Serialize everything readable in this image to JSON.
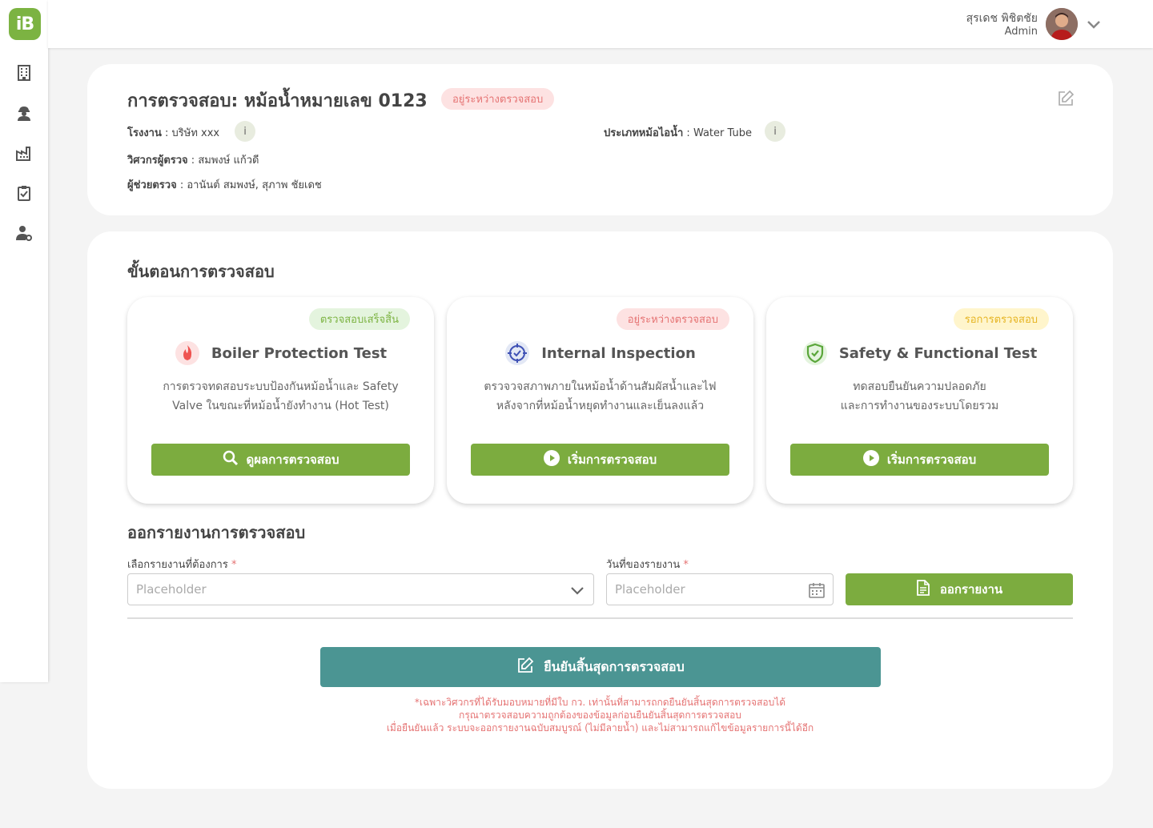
{
  "app": {
    "logo_text": "iB"
  },
  "user": {
    "name": "สุรเดช พิชิตชัย",
    "role": "Admin"
  },
  "inspection": {
    "title": "การตรวจสอบ: หม้อน้ำหมายเลข 0123",
    "status": "อยู่ระหว่างตรวจสอบ",
    "factory_label": "โรงงาน",
    "factory_value": "บริษัท xxx",
    "boiler_type_label": "ประเภทหม้อไอน้ำ",
    "boiler_type_value": "Water Tube",
    "engineer_label": "วิศวกรผู้ตรวจ",
    "engineer_value": "สมพงษ์ แก้วดี",
    "assistant_label": "ผู้ช่วยตรวจ",
    "assistant_value": "อานันต์ สมพงษ์, สุภาพ ชัยเดช",
    "info_icon": "i"
  },
  "steps_section": {
    "title": "ขั้นตอนการตรวจสอบ",
    "steps": [
      {
        "status": "ตรวจสอบเสร็จสิ้น",
        "title": "Boiler Protection Test",
        "desc_line1": "การตรวจทดสอบระบบป้องกันหม้อน้ำและ Safety",
        "desc_line2": "Valve ในขณะที่หม้อน้ำยังทำงาน (Hot Test)",
        "button": "ดูผลการตรวจสอบ",
        "icon": "flame-icon"
      },
      {
        "status": "อยู่ระหว่างตรวจสอบ",
        "title": "Internal Inspection",
        "desc_line1": "ตรวจวจสภาพภายในหม้อน้ำด้านสัมผัสน้ำและไฟ",
        "desc_line2": "หลังจากที่หม้อน้ำหยุดทำงานและเย็นลงแล้ว",
        "button": "เริ่มการตรวจสอบ",
        "icon": "target-check-icon"
      },
      {
        "status": "รอการตรวจสอบ",
        "title": "Safety & Functional Test",
        "desc_line1": "ทดสอบยืนยันความปลอดภัย",
        "desc_line2": "และการทำงานของระบบโดยรวม",
        "button": "เริ่มการตรวจสอบ",
        "icon": "shield-check-icon"
      }
    ]
  },
  "report": {
    "title": "ออกรายงานการตรวจสอบ",
    "select_label": "เลือกรายงานที่ต้องการ",
    "select_placeholder": "Placeholder",
    "date_label": "วันที่ของรายงาน",
    "date_placeholder": "Placeholder",
    "required_mark": "*",
    "export_button": "ออกรายงาน"
  },
  "confirm": {
    "button": "ยืนยันสิ้นสุดการตรวจสอบ",
    "note1": "*เฉพาะวิศวกรที่ได้รับมอบหมายที่มีใบ กว. เท่านั้นที่สามารถกดยืนยันสิ้นสุดการตรวจสอบได้",
    "note2": "กรุณาตรวจสอบความถูกต้องของข้อมูลก่อนยืนยันสิ้นสุดการตรวจสอบ",
    "note3": "เมื่อยืนยันแล้ว ระบบจะออกรายงานฉบับสมบูรณ์ (ไม่มีลายน้ำ) และไม่สามารถแก้ไขข้อมูลรายการนี้ได้อีก"
  },
  "colors": {
    "primary_green": "#7cac3f",
    "teal": "#4b9593",
    "danger": "#e57373",
    "warning": "#e6b422"
  }
}
